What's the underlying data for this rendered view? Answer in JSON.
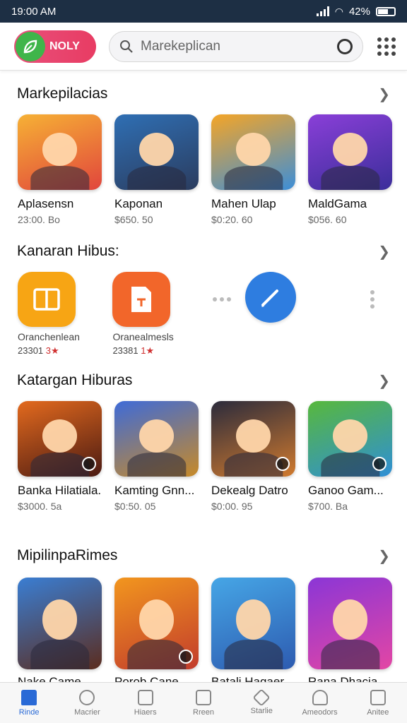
{
  "status": {
    "time": "19:00 AM",
    "battery": "42%"
  },
  "header": {
    "logo_text": "NOLY",
    "search_placeholder": "Marekeplican"
  },
  "sections": [
    {
      "title": "Markepilacias",
      "items": [
        {
          "name": "Aplasensn",
          "price": "23:00. Bo",
          "colors": [
            "#f6b135",
            "#e1453c"
          ]
        },
        {
          "name": "Kaponan",
          "price": "$650. 50",
          "colors": [
            "#2f6fb4",
            "#2b3c5e"
          ]
        },
        {
          "name": "Mahen Ulap",
          "price": "$0:20. 60",
          "colors": [
            "#f5a526",
            "#3c8ed8"
          ]
        },
        {
          "name": "MaldGama",
          "price": "$056. 60",
          "colors": [
            "#8a3fd8",
            "#3b2e9a"
          ]
        }
      ]
    },
    {
      "title": "Katargan Hiburas",
      "items": [
        {
          "name": "Banka Hilatiala..",
          "price": "$3000. 5a",
          "colors": [
            "#e36a1e",
            "#4b1a12"
          ]
        },
        {
          "name": "Kamting Gnn...",
          "price": "$0:50. 05",
          "colors": [
            "#3e6bd8",
            "#c78a28"
          ]
        },
        {
          "name": "Dekealg Datro",
          "price": "$0:00. 95",
          "colors": [
            "#2b2b3c",
            "#d07a2e"
          ]
        },
        {
          "name": "Ganoo Gam...",
          "price": "$700. Ba",
          "colors": [
            "#58b83c",
            "#2f8fd6"
          ]
        }
      ]
    },
    {
      "title": "MipilinpaRimes",
      "items": [
        {
          "name": "Nake Came",
          "price": "",
          "colors": [
            "#3a7ed3",
            "#5b2c1e"
          ]
        },
        {
          "name": "Porob Cane",
          "price": "",
          "colors": [
            "#f2961e",
            "#c23c2c"
          ]
        },
        {
          "name": "Batali Hagaer...",
          "price": "",
          "colors": [
            "#46a6e6",
            "#2d5bb0"
          ]
        },
        {
          "name": "Rana Dhacia...",
          "price": "",
          "colors": [
            "#8b36d6",
            "#e346a4"
          ]
        }
      ]
    }
  ],
  "hiburan": {
    "title": "Kanaran Hibus:",
    "apps": [
      {
        "name": "Oranchenlean",
        "meta": "23301",
        "stars": "3★",
        "color": "#f7a514",
        "icon": "book-icon"
      },
      {
        "name": "Oranealmesls",
        "meta": "23381",
        "stars": "1★",
        "color": "#f2662a",
        "icon": "document-icon"
      },
      {
        "name": "",
        "meta": "",
        "stars": "",
        "color": "",
        "icon": "dots-icon"
      },
      {
        "name": "",
        "meta": "",
        "stars": "",
        "color": "#2e7de0",
        "icon": "pen-icon"
      },
      {
        "name": "",
        "meta": "",
        "stars": "",
        "color": "",
        "icon": "dots-icon"
      }
    ]
  },
  "nav": [
    {
      "label": "Rinde",
      "icon": "home-icon",
      "active": true
    },
    {
      "label": "Macrier",
      "icon": "search-icon",
      "active": false
    },
    {
      "label": "Hiaers",
      "icon": "calendar-icon",
      "active": false
    },
    {
      "label": "Rreen",
      "icon": "edit-icon",
      "active": false
    },
    {
      "label": "Starlie",
      "icon": "tag-icon",
      "active": false
    },
    {
      "label": "Ameodors",
      "icon": "person-icon",
      "active": false
    },
    {
      "label": "Anitee",
      "icon": "doc-icon",
      "active": false
    }
  ]
}
